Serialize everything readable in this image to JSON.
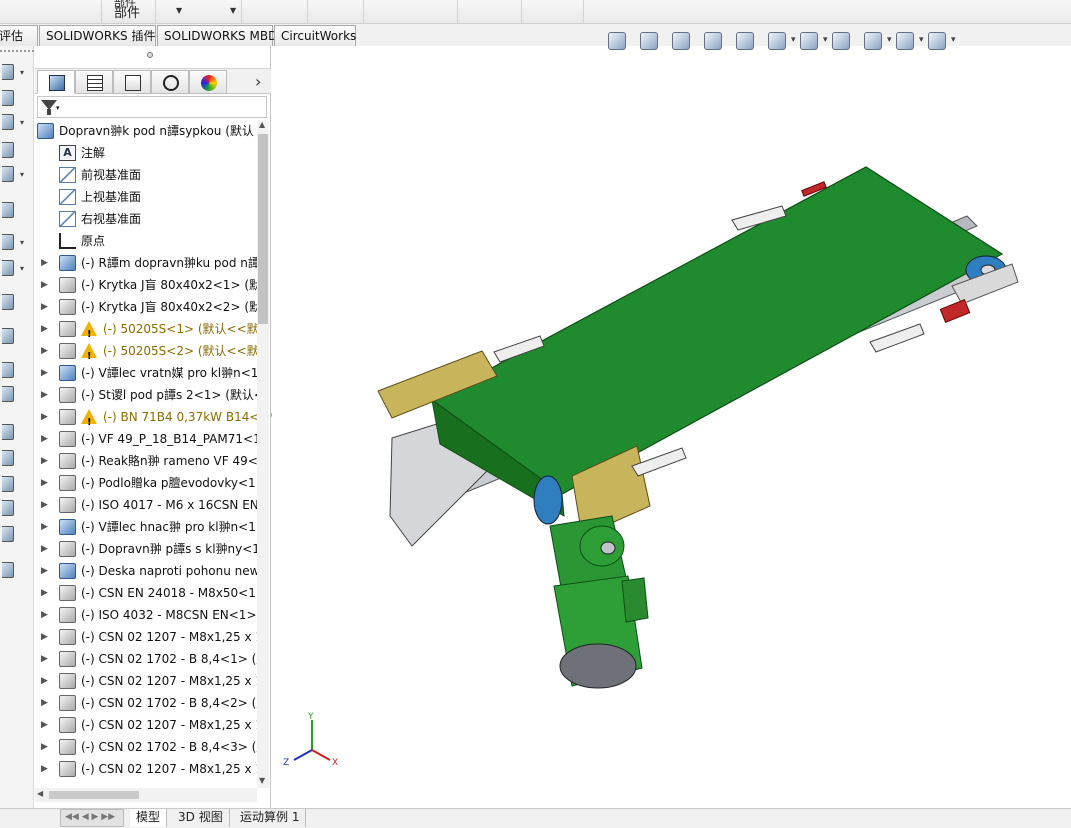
{
  "ribbon": {
    "eval_label": "评估",
    "components_label_line1": "部件",
    "components_label_line2": "部件"
  },
  "command_tabs": [
    "评估",
    "SOLIDWORKS 插件",
    "SOLIDWORKS MBD",
    "CircuitWorks"
  ],
  "feature_manager": {
    "tabs": [
      "feature-manager-tree",
      "property-manager",
      "configuration-manager",
      "dimxpert-manager",
      "display-manager"
    ],
    "filter_icon": "funnel-icon",
    "root": "Dopravn翀k pod n譚sypkou  (默认<",
    "items": [
      {
        "icon": "annotation-icon",
        "label": "注解",
        "expand": false,
        "warn": false
      },
      {
        "icon": "plane-icon",
        "label": "前视基准面",
        "expand": false,
        "warn": false
      },
      {
        "icon": "plane-icon",
        "label": "上视基准面",
        "expand": false,
        "warn": false
      },
      {
        "icon": "plane-icon",
        "label": "右视基准面",
        "expand": false,
        "warn": false
      },
      {
        "icon": "origin-icon",
        "label": "原点",
        "expand": false,
        "warn": false
      },
      {
        "icon": "assembly-icon",
        "label": "(-) R譚m dopravn翀ku pod n譚",
        "expand": true,
        "warn": false
      },
      {
        "icon": "part-icon",
        "label": "(-) Krytka J盲 80x40x2<1> (默认",
        "expand": true,
        "warn": false
      },
      {
        "icon": "part-icon",
        "label": "(-) Krytka J盲 80x40x2<2> (默认",
        "expand": true,
        "warn": false
      },
      {
        "icon": "part-icon",
        "label": "(-) 50205S<1> (默认<<默认",
        "expand": true,
        "warn": true
      },
      {
        "icon": "part-icon",
        "label": "(-) 50205S<2> (默认<<默认",
        "expand": true,
        "warn": true
      },
      {
        "icon": "assembly-icon",
        "label": "(-) V譚lec vratn媒 pro kl翀n<1",
        "expand": true,
        "warn": false
      },
      {
        "icon": "part-icon",
        "label": "(-) St谡l pod p譚s 2<1> (默认<",
        "expand": true,
        "warn": false
      },
      {
        "icon": "part-icon",
        "label": "(-) BN 71B4 0,37kW B14<",
        "expand": true,
        "warn": true
      },
      {
        "icon": "part-icon",
        "label": "(-) VF 49_P_18_B14_PAM71<1>",
        "expand": true,
        "warn": false
      },
      {
        "icon": "part-icon",
        "label": "(-) Reak賂n翀 rameno VF 49<",
        "expand": true,
        "warn": false
      },
      {
        "icon": "part-icon",
        "label": "(-) Podlo贈ka p膻evodovky<1",
        "expand": true,
        "warn": false
      },
      {
        "icon": "part-icon",
        "label": "(-) ISO 4017 - M6 x 16CSN EN",
        "expand": true,
        "warn": false
      },
      {
        "icon": "assembly-icon",
        "label": "(-) V譚lec hnac翀 pro kl翀n<1:",
        "expand": true,
        "warn": false
      },
      {
        "icon": "part-icon",
        "label": "(-) Dopravn翀 p譚s s kl翀ny<1",
        "expand": true,
        "warn": false
      },
      {
        "icon": "assembly-icon",
        "label": "(-) Deska naproti pohonu new",
        "expand": true,
        "warn": false
      },
      {
        "icon": "part-icon",
        "label": "(-) CSN EN 24018 - M8x50<1>",
        "expand": true,
        "warn": false
      },
      {
        "icon": "part-icon",
        "label": "(-) ISO 4032 - M8CSN EN<1>",
        "expand": true,
        "warn": false
      },
      {
        "icon": "part-icon",
        "label": "(-) CSN 02 1207 - M8x1,25 x 1",
        "expand": true,
        "warn": false
      },
      {
        "icon": "part-icon",
        "label": "(-) CSN 02 1702 - B 8,4<1> (默",
        "expand": true,
        "warn": false
      },
      {
        "icon": "part-icon",
        "label": "(-) CSN 02 1207 - M8x1,25 x 1",
        "expand": true,
        "warn": false
      },
      {
        "icon": "part-icon",
        "label": "(-) CSN 02 1702 - B 8,4<2> (默",
        "expand": true,
        "warn": false
      },
      {
        "icon": "part-icon",
        "label": "(-) CSN 02 1207 - M8x1,25 x 1",
        "expand": true,
        "warn": false
      },
      {
        "icon": "part-icon",
        "label": "(-) CSN 02 1702 - B 8,4<3> (默",
        "expand": true,
        "warn": false
      },
      {
        "icon": "part-icon",
        "label": "(-) CSN 02 1207 - M8x1,25 x 1",
        "expand": true,
        "warn": false
      }
    ]
  },
  "heads_up_toolbar": [
    "zoom-to-fit-icon",
    "zoom-area-icon",
    "previous-view-icon",
    "section-view-icon",
    "dynamic-annotation-icon",
    "view-orientation-icon",
    "display-style-icon",
    "hide-show-icon",
    "appearance-icon",
    "scene-icon",
    "view-settings-icon"
  ],
  "triad": {
    "x": "X",
    "y": "Y",
    "z": "Z"
  },
  "colors": {
    "belt": "#1f8a2e",
    "motor": "#2e9e36",
    "frame": "#c9ccd1",
    "bracket": "#c8b45a",
    "roller": "#2f7fc0",
    "accent_red": "#c0282a"
  },
  "bottom_tabs": [
    "模型",
    "3D 视图",
    "运动算例 1"
  ]
}
